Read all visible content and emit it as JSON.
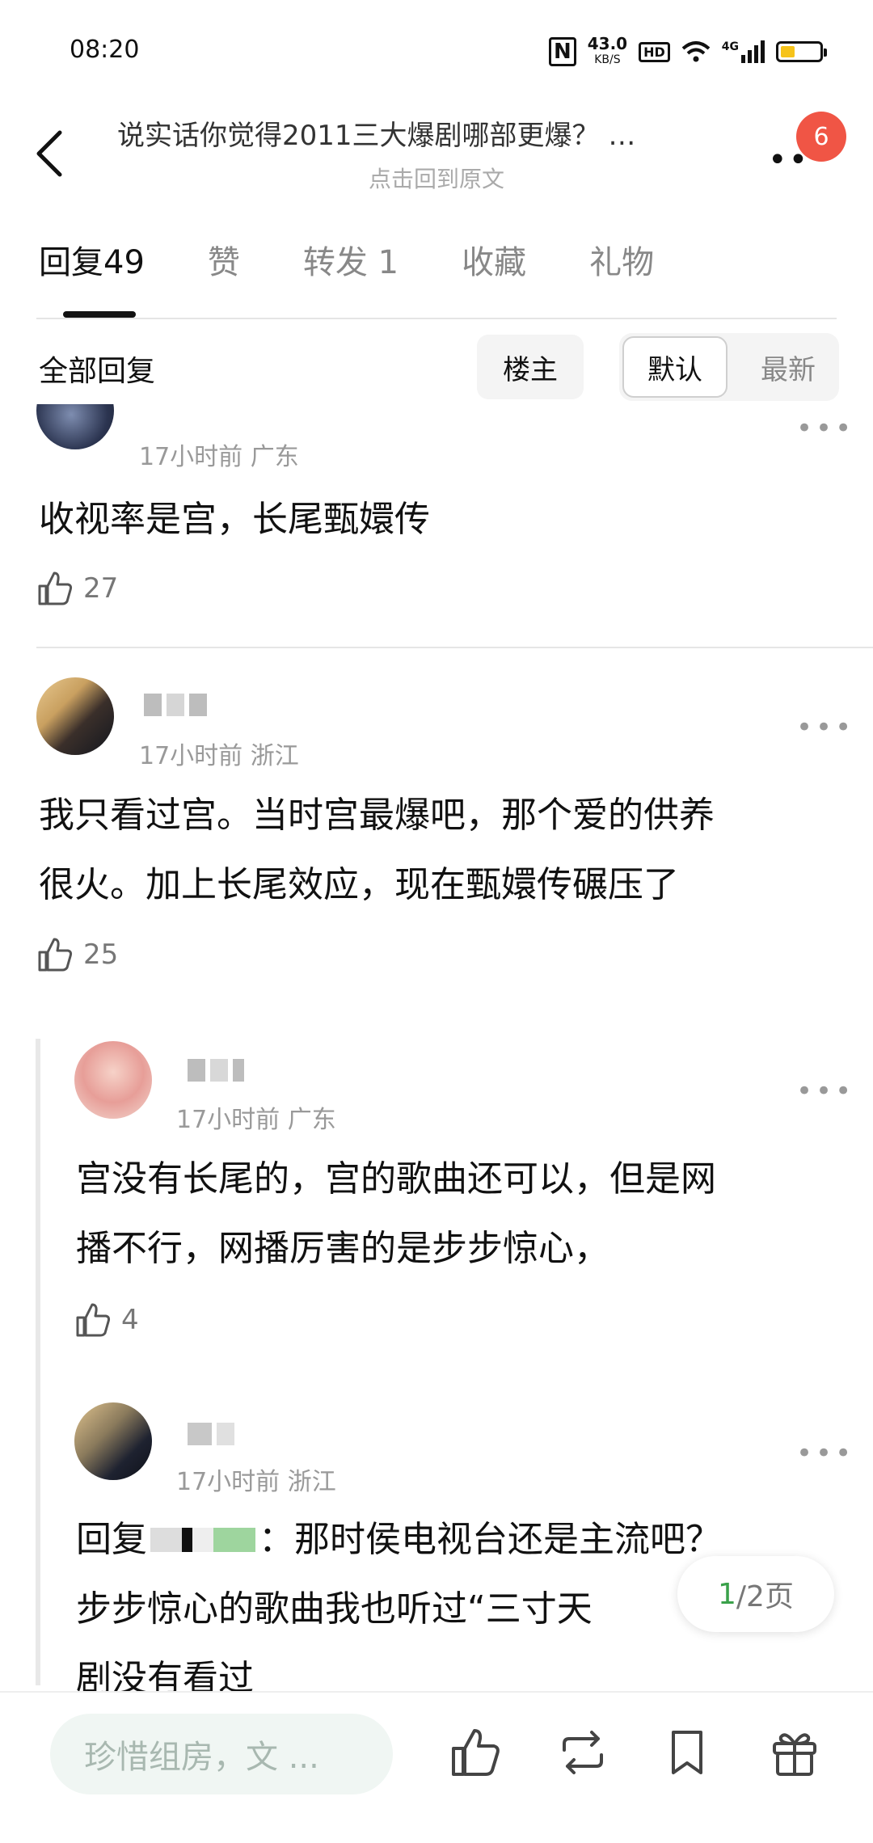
{
  "status_bar": {
    "time": "08:20",
    "net_speed": "43.0",
    "net_unit": "KB/S",
    "hd": "HD",
    "signal": "4G"
  },
  "header": {
    "title": "说实话你觉得2011三大爆剧哪部更爆？ …",
    "subtitle": "点击回到原文",
    "badge": "6"
  },
  "tabs": [
    {
      "label": "回复49",
      "active": true
    },
    {
      "label": "赞",
      "active": false
    },
    {
      "label": "转发 1",
      "active": false
    },
    {
      "label": "收藏",
      "active": false
    },
    {
      "label": "礼物",
      "active": false
    }
  ],
  "filter": {
    "all_label": "全部回复",
    "owner_label": "楼主",
    "default_label": "默认",
    "newest_label": "最新"
  },
  "comments": [
    {
      "meta": "17小时前 广东",
      "text": "收视率是宫，长尾甄嬛传",
      "likes": "27"
    },
    {
      "meta": "17小时前 浙江",
      "text_line1": "我只看过宫。当时宫最爆吧，那个爱的供养",
      "text_line2": "很火。加上长尾效应，现在甄嬛传碾压了",
      "likes": "25"
    }
  ],
  "replies": [
    {
      "meta": "17小时前 广东",
      "text_line1": "宫没有长尾的，宫的歌曲还可以，但是网",
      "text_line2": "播不行，网播厉害的是步步惊心，",
      "likes": "4"
    },
    {
      "meta": "17小时前 浙江",
      "prefix": "回复",
      "text_line1_tail": "：那时侯电视台还是主流吧？",
      "text_line2": "步步惊心的歌曲我也听过“三寸天",
      "text_line3": "剧没有看过"
    }
  ],
  "pager": {
    "current": "1",
    "total": "/2页"
  },
  "bottom": {
    "placeholder": "珍惜组房，文 ..."
  },
  "colors": {
    "accent_green": "#3aa14a",
    "badge_red": "#f05545",
    "battery_yellow": "#f6c31a"
  }
}
